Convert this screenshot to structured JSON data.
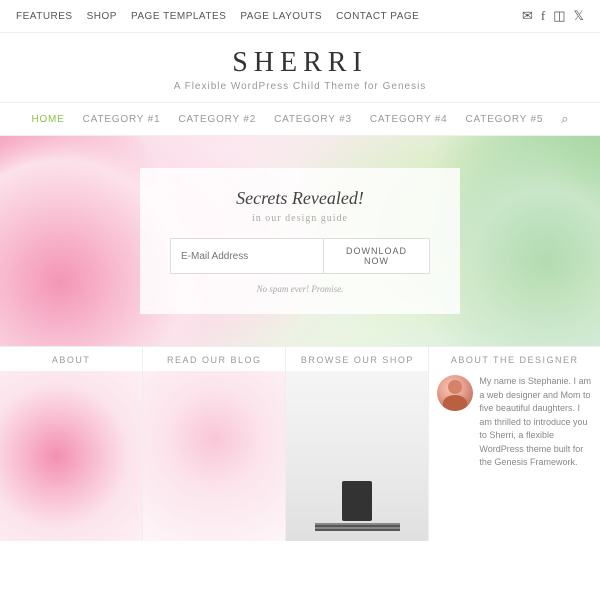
{
  "topNav": {
    "links": [
      {
        "label": "FEATURES",
        "id": "features"
      },
      {
        "label": "SHOP",
        "id": "shop"
      },
      {
        "label": "PAGE TEMPLATES",
        "id": "page-templates"
      },
      {
        "label": "PAGE LAYOUTS",
        "id": "page-layouts"
      },
      {
        "label": "CONTACT PAGE",
        "id": "contact-page"
      }
    ],
    "icons": [
      "email",
      "facebook",
      "instagram",
      "twitter"
    ]
  },
  "header": {
    "title": "SHERRI",
    "tagline": "A Flexible WordPress Child Theme for Genesis"
  },
  "mainNav": {
    "items": [
      {
        "label": "HOME",
        "active": true
      },
      {
        "label": "CATEGORY #1",
        "active": false
      },
      {
        "label": "CATEGORY #2",
        "active": false
      },
      {
        "label": "CATEGORY #3",
        "active": false
      },
      {
        "label": "CATEGORY #4",
        "active": false
      },
      {
        "label": "CATEGORY #5",
        "active": false
      }
    ]
  },
  "hero": {
    "title": "Secrets Revealed!",
    "subtitle": "in our design guide",
    "emailPlaceholder": "E-Mail Address",
    "buttonLabel": "DOWNLOAD NOW",
    "note": "No spam ever! Promise."
  },
  "bottomCards": [
    {
      "label": "ABOUT",
      "imageType": "flowers-pink"
    },
    {
      "label": "READ OUR BLOG",
      "imageType": "flowers-light"
    },
    {
      "label": "BROWSE OUR SHOP",
      "imageType": "desk"
    }
  ],
  "aboutDesigner": {
    "label": "ABOUT THE DESIGNER",
    "text": "My name is Stephanie. I am a web designer and Mom to five beautiful daughters. I am thrilled to introduce you to Sherri, a flexible WordPress theme built for the Genesis Framework."
  }
}
